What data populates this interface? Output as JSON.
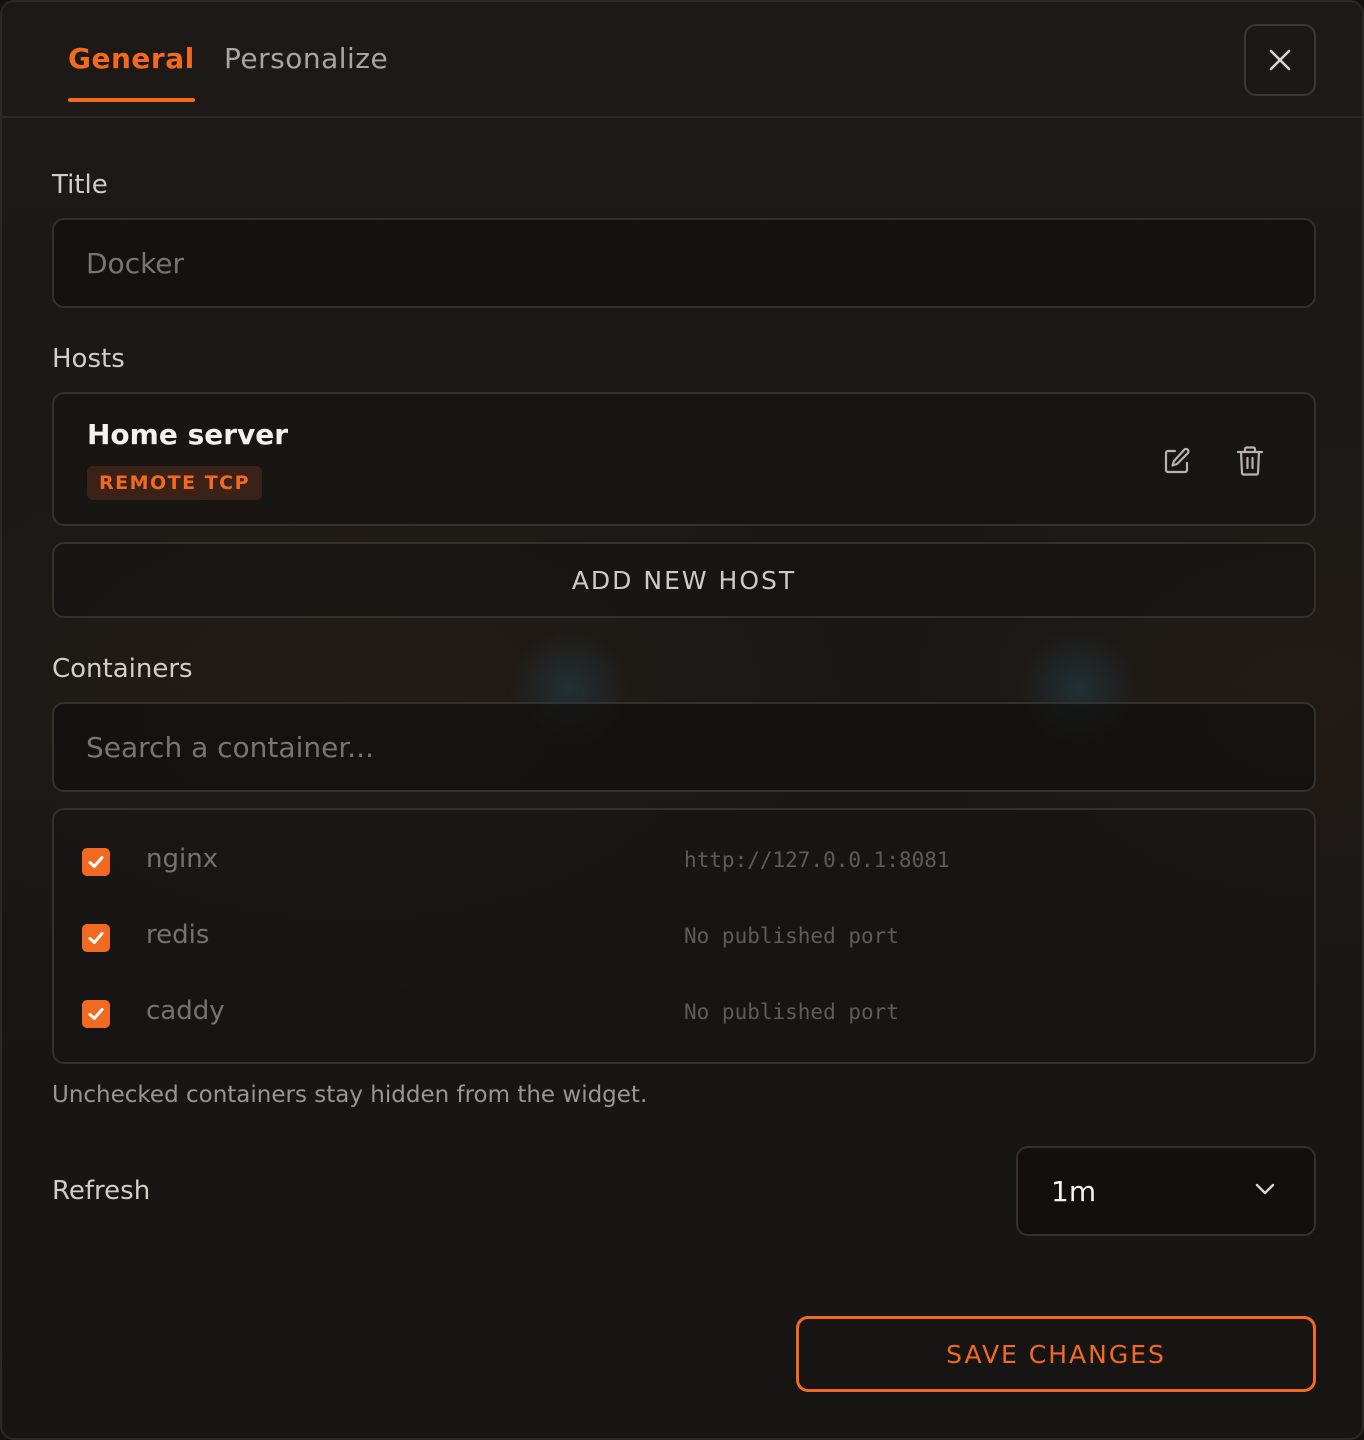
{
  "tabs": [
    {
      "label": "General",
      "active": true
    },
    {
      "label": "Personalize",
      "active": false
    }
  ],
  "close_icon": "close-icon",
  "title_field": {
    "label": "Title",
    "placeholder": "Docker",
    "value": ""
  },
  "hosts": {
    "label": "Hosts",
    "items": [
      {
        "name": "Home server",
        "badge": "REMOTE TCP",
        "actions": [
          "edit-icon",
          "trash-icon"
        ]
      }
    ],
    "add_label": "ADD NEW HOST"
  },
  "containers": {
    "label": "Containers",
    "search_placeholder": "Search a container...",
    "items": [
      {
        "name": "nginx",
        "port": "http://127.0.0.1:8081",
        "checked": true
      },
      {
        "name": "redis",
        "port": "No published port",
        "checked": true
      },
      {
        "name": "caddy",
        "port": "No published port",
        "checked": true
      }
    ],
    "hint": "Unchecked containers stay hidden from the widget."
  },
  "refresh": {
    "label": "Refresh",
    "value": "1m",
    "icon": "chevron-down-icon"
  },
  "save_label": "SAVE CHANGES",
  "colors": {
    "accent": "#f26a21",
    "background": "#1a1816",
    "border": "#33302d"
  }
}
